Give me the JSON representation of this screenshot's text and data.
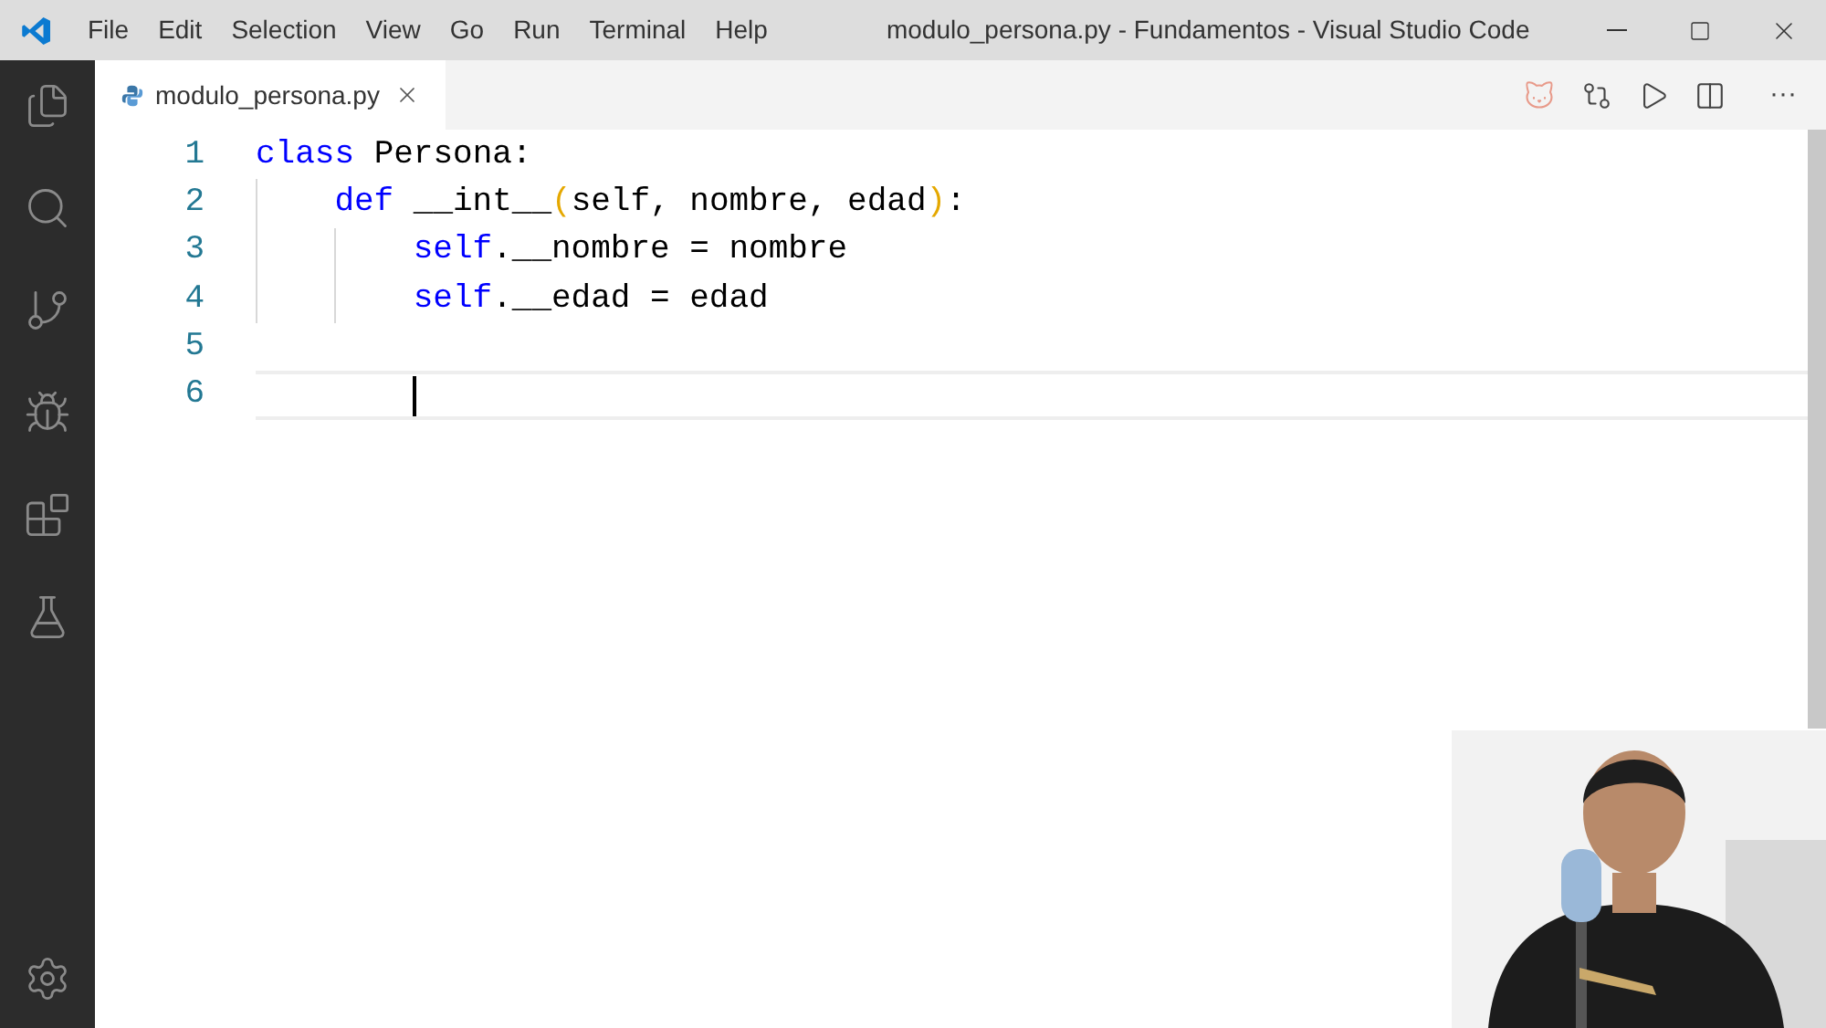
{
  "menu": [
    "File",
    "Edit",
    "Selection",
    "View",
    "Go",
    "Run",
    "Terminal",
    "Help"
  ],
  "window": {
    "title": "modulo_persona.py - Fundamentos - Visual Studio Code"
  },
  "tabs": [
    {
      "label": "modulo_persona.py",
      "selected": true
    }
  ],
  "editor_actions": {
    "more": "···"
  },
  "editor": {
    "lines": [
      {
        "number": "1",
        "current": false,
        "tokens": [
          {
            "kind": "keyword",
            "text": "class"
          },
          {
            "kind": "plain",
            "text": " Persona:"
          }
        ],
        "children": [
          {
            "number": "2",
            "current": false,
            "tokens": [
              {
                "kind": "keyword",
                "text": "def"
              },
              {
                "kind": "plain",
                "text": " __int__"
              },
              {
                "kind": "bracket",
                "text": "("
              },
              {
                "kind": "plain",
                "text": "self, nombre, edad"
              },
              {
                "kind": "bracket",
                "text": ")"
              },
              {
                "kind": "plain",
                "text": ":"
              }
            ],
            "children": [
              {
                "number": "3",
                "current": false,
                "tokens": [
                  {
                    "kind": "keyword",
                    "text": "self"
                  },
                  {
                    "kind": "plain",
                    "text": ".__nombre = nombre"
                  }
                ]
              },
              {
                "number": "4",
                "current": false,
                "tokens": [
                  {
                    "kind": "keyword",
                    "text": "self"
                  },
                  {
                    "kind": "plain",
                    "text": ".__edad = edad"
                  }
                ]
              }
            ]
          }
        ]
      },
      {
        "number": "5",
        "current": false
      },
      {
        "number": "6",
        "current": true
      }
    ]
  }
}
